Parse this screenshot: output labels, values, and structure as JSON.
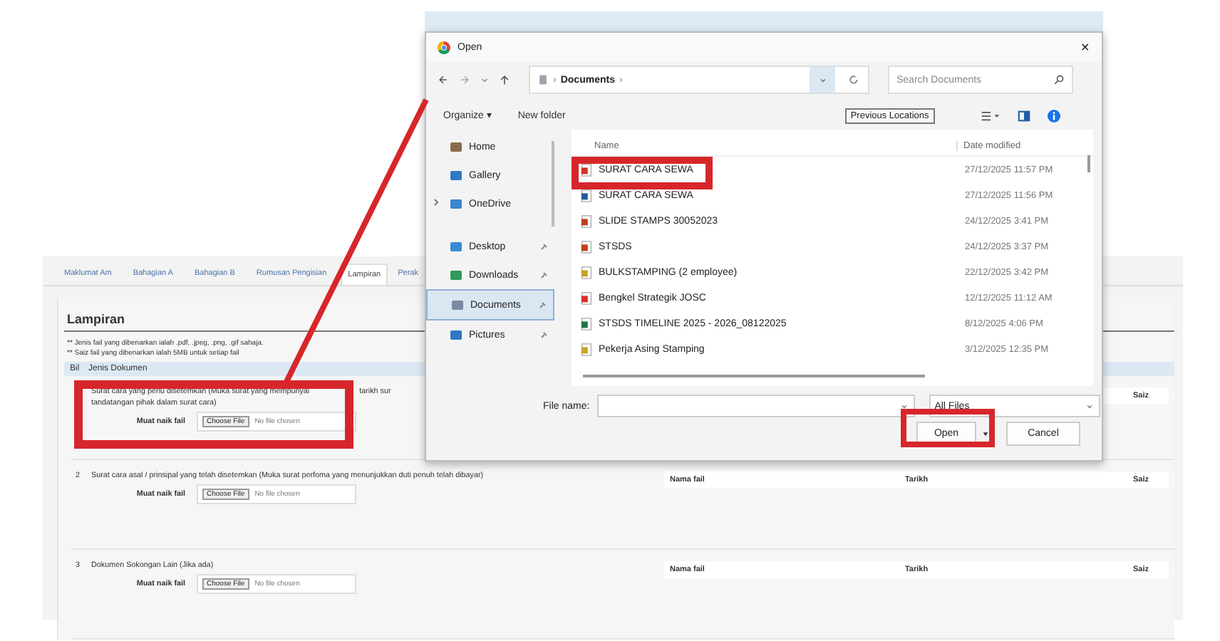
{
  "page": {
    "tabs": [
      {
        "label": "Maklumat Am",
        "selected": false
      },
      {
        "label": "Bahagian A",
        "selected": false
      },
      {
        "label": "Bahagian B",
        "selected": false
      },
      {
        "label": "Rumusan Pengisian",
        "selected": false
      },
      {
        "label": "Lampiran",
        "selected": true
      },
      {
        "label": "Perak",
        "selected": false
      }
    ],
    "heading": "Lampiran",
    "notes": [
      "** Jenis fail yang dibenarkan ialah .pdf, .jpeg, .png, .gif sahaja.",
      "** Saiz fail yang dibenarkan ialah 5MB untuk setiap fail"
    ],
    "table_header": {
      "no": "Bil",
      "document": "Jenis Dokumen"
    },
    "rows": [
      {
        "title": "Surat cara yang perlu disetemkan (Muka surat yang mempunyai",
        "title_tail": "tarikh sur",
        "title_line_2": "tandatangan pihak dalam surat cara)",
        "upload_label": "Muat naik fail",
        "choose_button": "Choose File",
        "file_status": "No file chosen",
        "file_columns": [
          {
            "kind": "size",
            "label": "Saiz"
          }
        ]
      },
      {
        "no": "2",
        "title": "Surat cara asal / prinsipal yang telah disetemkan (Muka surat perfoma yang menunjukkan duti penuh telah dibayar)",
        "upload_label": "Muat naik fail",
        "choose_button": "Choose File",
        "file_status": "No file chosen",
        "file_columns": [
          {
            "kind": "name",
            "label": "Nama fail"
          },
          {
            "kind": "date",
            "label": "Tarikh"
          },
          {
            "kind": "size",
            "label": "Saiz"
          }
        ]
      },
      {
        "no": "3",
        "title": "Dokumen Sokongan Lain (Jika ada)",
        "upload_label": "Muat naik fail",
        "choose_button": "Choose File",
        "file_status": "No file chosen",
        "file_columns": [
          {
            "kind": "name",
            "label": "Nama fail"
          },
          {
            "kind": "date",
            "label": "Tarikh"
          },
          {
            "kind": "size",
            "label": "Saiz"
          }
        ]
      }
    ]
  },
  "dialog": {
    "title": "Open",
    "close": "✕",
    "path": "Documents",
    "path_separator": "›",
    "search_placeholder": "Search Documents",
    "organize": "Organize ▾",
    "new_folder": "New folder",
    "tooltip": "Previous Locations",
    "nav": [
      {
        "label": "Home",
        "kind": "home",
        "pinned": false,
        "expander": false,
        "selected": false
      },
      {
        "label": "Gallery",
        "kind": "gallery",
        "pinned": false,
        "expander": false,
        "selected": false
      },
      {
        "label": "OneDrive",
        "kind": "cloud",
        "pinned": false,
        "expander": true,
        "selected": false
      },
      {
        "label": "Desktop",
        "kind": "desktop",
        "pinned": true,
        "expander": false,
        "selected": false
      },
      {
        "label": "Downloads",
        "kind": "download",
        "pinned": true,
        "expander": false,
        "selected": false
      },
      {
        "label": "Documents",
        "kind": "documents",
        "pinned": true,
        "expander": false,
        "selected": true
      },
      {
        "label": "Pictures",
        "kind": "gallery",
        "pinned": true,
        "expander": false,
        "selected": false
      }
    ],
    "columns": [
      "Name",
      "Date modified"
    ],
    "files": [
      {
        "name": "SURAT CARA SEWA",
        "date": "27/12/2025 11:57 PM",
        "kind": "pdf"
      },
      {
        "name": "SURAT CARA SEWA",
        "date": "27/12/2025 11:56 PM",
        "kind": "word"
      },
      {
        "name": "SLIDE STAMPS 30052023",
        "date": "24/12/2025 3:41 PM",
        "kind": "ppt"
      },
      {
        "name": "STSDS",
        "date": "24/12/2025 3:37 PM",
        "kind": "ppt"
      },
      {
        "name": "BULKSTAMPING (2 employee)",
        "date": "22/12/2025 3:42 PM",
        "kind": "image"
      },
      {
        "name": "Bengkel Strategik JOSC",
        "date": "12/12/2025 11:12 AM",
        "kind": "pdf"
      },
      {
        "name": "STSDS TIMELINE 2025 - 2026_08122025",
        "date": "8/12/2025 4:06 PM",
        "kind": "excel"
      },
      {
        "name": "Pekerja Asing Stamping",
        "date": "3/12/2025 12:35 PM",
        "kind": "image"
      }
    ],
    "file_name_label": "File name:",
    "filter": "All Files",
    "open": "Open",
    "cancel": "Cancel"
  }
}
